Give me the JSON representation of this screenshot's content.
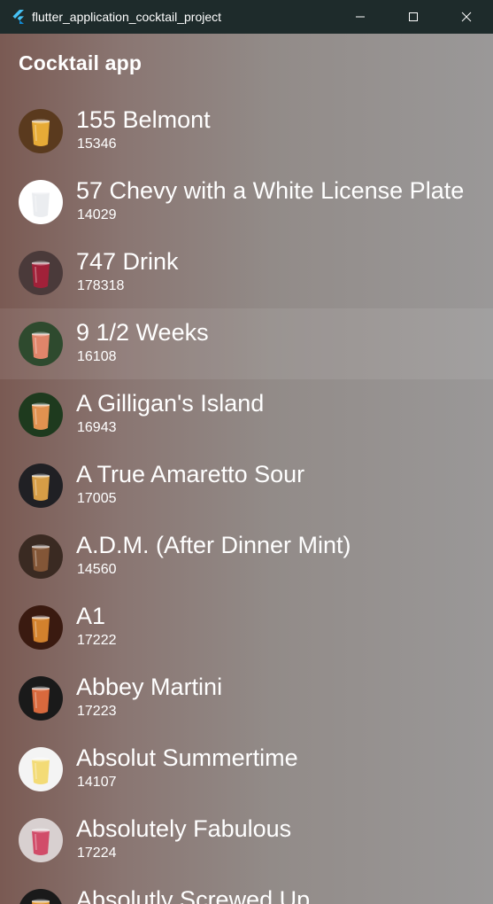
{
  "window": {
    "title": "flutter_application_cocktail_project"
  },
  "appbar": {
    "title": "Cocktail app"
  },
  "cocktails": [
    {
      "name": "155 Belmont",
      "id": "15346",
      "bg": "#5a3a1e",
      "glass": "#f3b53a"
    },
    {
      "name": "57 Chevy with a White License Plate",
      "id": "14029",
      "bg": "#ffffff",
      "glass": "#e9ecef"
    },
    {
      "name": "747 Drink",
      "id": "178318",
      "bg": "#4a3a3a",
      "glass": "#a8203a"
    },
    {
      "name": "9 1/2 Weeks",
      "id": "16108",
      "bg": "#2e4a2e",
      "glass": "#f08a70"
    },
    {
      "name": "A Gilligan's Island",
      "id": "16943",
      "bg": "#1e3a1e",
      "glass": "#f29a55"
    },
    {
      "name": "A True Amaretto Sour",
      "id": "17005",
      "bg": "#202024",
      "glass": "#e6a84a"
    },
    {
      "name": "A.D.M. (After Dinner Mint)",
      "id": "14560",
      "bg": "#3a2a22",
      "glass": "#8a5a3a"
    },
    {
      "name": "A1",
      "id": "17222",
      "bg": "#3a1a10",
      "glass": "#e08a30"
    },
    {
      "name": "Abbey Martini",
      "id": "17223",
      "bg": "#1a1a1a",
      "glass": "#e87040"
    },
    {
      "name": "Absolut Summertime",
      "id": "14107",
      "bg": "#f4f4f4",
      "glass": "#f2d86a"
    },
    {
      "name": "Absolutely Fabulous",
      "id": "17224",
      "bg": "#d8d0d0",
      "glass": "#d04060"
    },
    {
      "name": "Absolutly Screwed Up",
      "id": "",
      "bg": "#1a1a1a",
      "glass": "#f0a030"
    }
  ]
}
